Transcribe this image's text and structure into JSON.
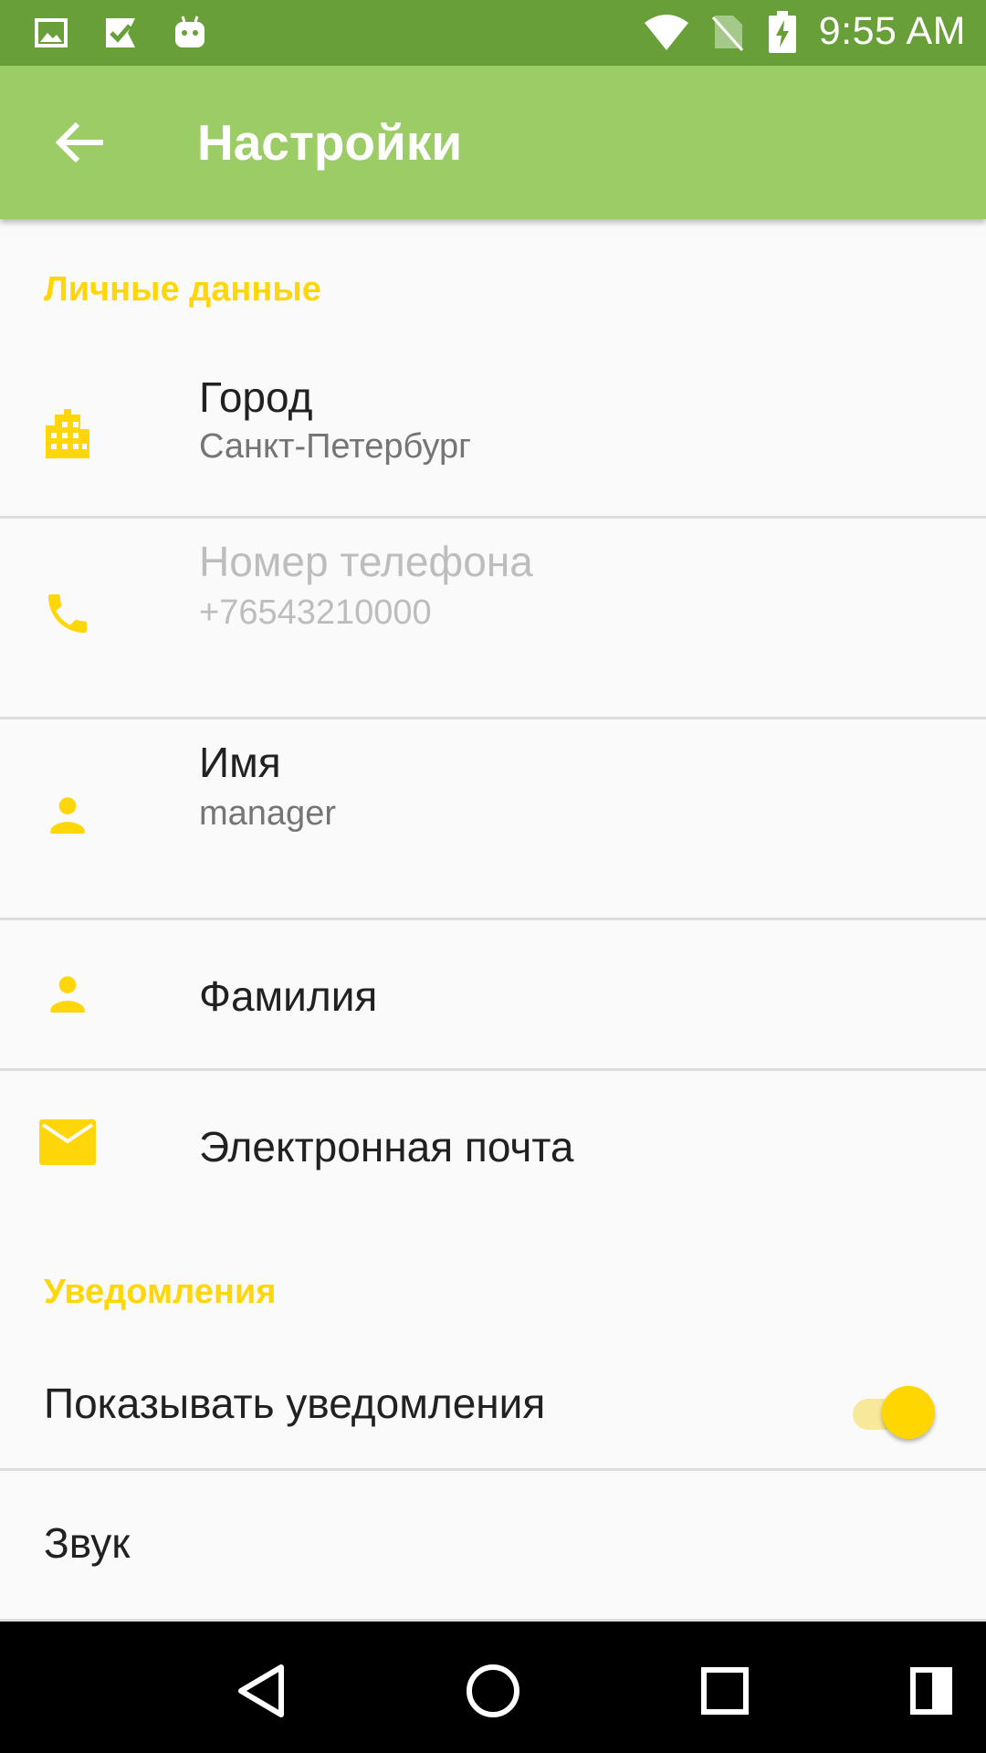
{
  "status_bar": {
    "time": "9:55 AM",
    "left_icons": [
      "image-icon",
      "check-flag-icon",
      "android-icon"
    ],
    "right_icons": [
      "wifi-icon",
      "no-sim-icon",
      "battery-charging-icon"
    ]
  },
  "app_bar": {
    "title": "Настройки",
    "back_icon": "arrow-back-icon",
    "background": "#9CCC65"
  },
  "sections": {
    "personal": {
      "header": "Личные данные",
      "items": [
        {
          "title": "Город",
          "summary": "Санкт-Петербург",
          "icon": "city-icon",
          "enabled": true
        },
        {
          "title": "Номер телефона",
          "summary": "+76543210000",
          "icon": "phone-icon",
          "enabled": false
        },
        {
          "title": "Имя",
          "summary": "manager",
          "icon": "person-icon",
          "enabled": true
        },
        {
          "title": "Фамилия",
          "summary": "",
          "icon": "person-icon",
          "enabled": true
        },
        {
          "title": "Электронная почта",
          "summary": "",
          "icon": "mail-icon",
          "enabled": true
        }
      ]
    },
    "notifications": {
      "header": "Уведомления",
      "show_notifications": {
        "title": "Показывать уведомления",
        "checked": true
      },
      "sound": {
        "title": "Звук"
      }
    }
  },
  "accent_color": "#FFD60A",
  "status_bar_color": "#689F38",
  "nav_bar": {
    "icons": [
      "back-triangle-icon",
      "home-circle-icon",
      "recents-square-icon",
      "split-screen-icon"
    ]
  }
}
